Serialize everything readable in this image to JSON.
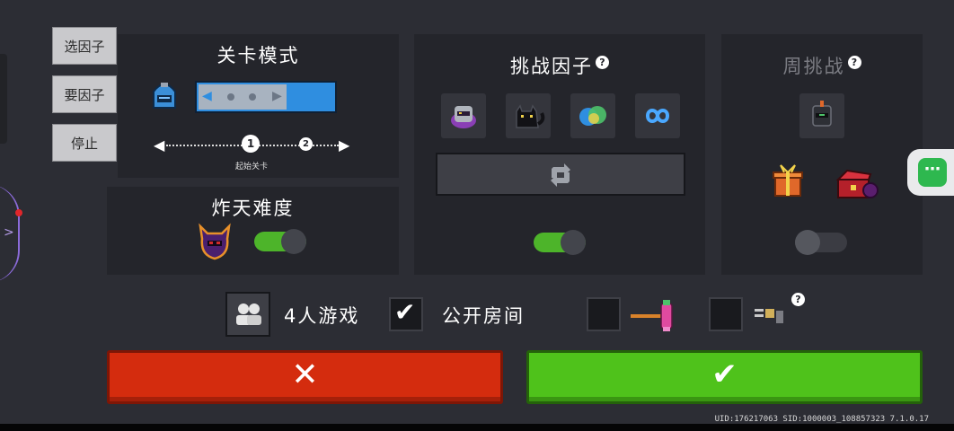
{
  "side_buttons": [
    {
      "label": "选因子"
    },
    {
      "label": "要因子"
    },
    {
      "label": "停止"
    }
  ],
  "level_mode": {
    "title": "关卡模式",
    "slider_nodes": [
      "1",
      "2"
    ],
    "start_label": "起始关卡"
  },
  "difficulty": {
    "title": "炸天难度",
    "toggle_on": true
  },
  "challenge": {
    "title": "挑战因子",
    "help": "?",
    "factor_icons": [
      "wizard-helmet-icon",
      "black-cat-icon",
      "orb-cluster-icon",
      "infinity-icon"
    ],
    "refresh_icon": "refresh-icon",
    "toggle_on": true
  },
  "weekly": {
    "title": "周挑战",
    "help": "?",
    "toggle_on": false,
    "icons": [
      "knight-helmet-icon",
      "gift-box-icon",
      "red-chest-icon"
    ]
  },
  "options": {
    "players_label": "4人游戏",
    "public_room_label": "公开房间",
    "public_room_checked": true,
    "help": "?"
  },
  "actions": {
    "cancel_symbol": "✕",
    "confirm_symbol": "✔"
  },
  "footer": {
    "ids": "UID:176217063 SID:1000003_108857323 7.1.0.17"
  },
  "colors": {
    "cancel": "#d42c0e",
    "confirm": "#4fc21b",
    "toggle_on": "#4db42a",
    "accent_blue": "#2f8ee0"
  }
}
